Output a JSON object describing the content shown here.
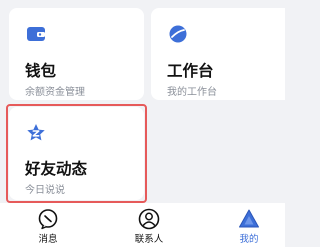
{
  "cards": {
    "wallet": {
      "title": "钱包",
      "subtitle": "余额资金管理",
      "icon": "wallet-icon"
    },
    "workbench": {
      "title": "工作台",
      "subtitle": "我的工作台",
      "icon": "workbench-icon"
    },
    "feed": {
      "title": "好友动态",
      "subtitle": "今日说说",
      "icon": "star-z-icon"
    }
  },
  "tabbar": {
    "messages": {
      "label": "消息",
      "icon": "chat-bubble-icon"
    },
    "contacts": {
      "label": "联系人",
      "icon": "person-icon"
    },
    "me": {
      "label": "我的",
      "icon": "triangle-icon",
      "active": true
    }
  },
  "colors": {
    "accent": "#3d6fd8",
    "highlight_border": "#e65a5a",
    "background": "#f1f2f5"
  }
}
